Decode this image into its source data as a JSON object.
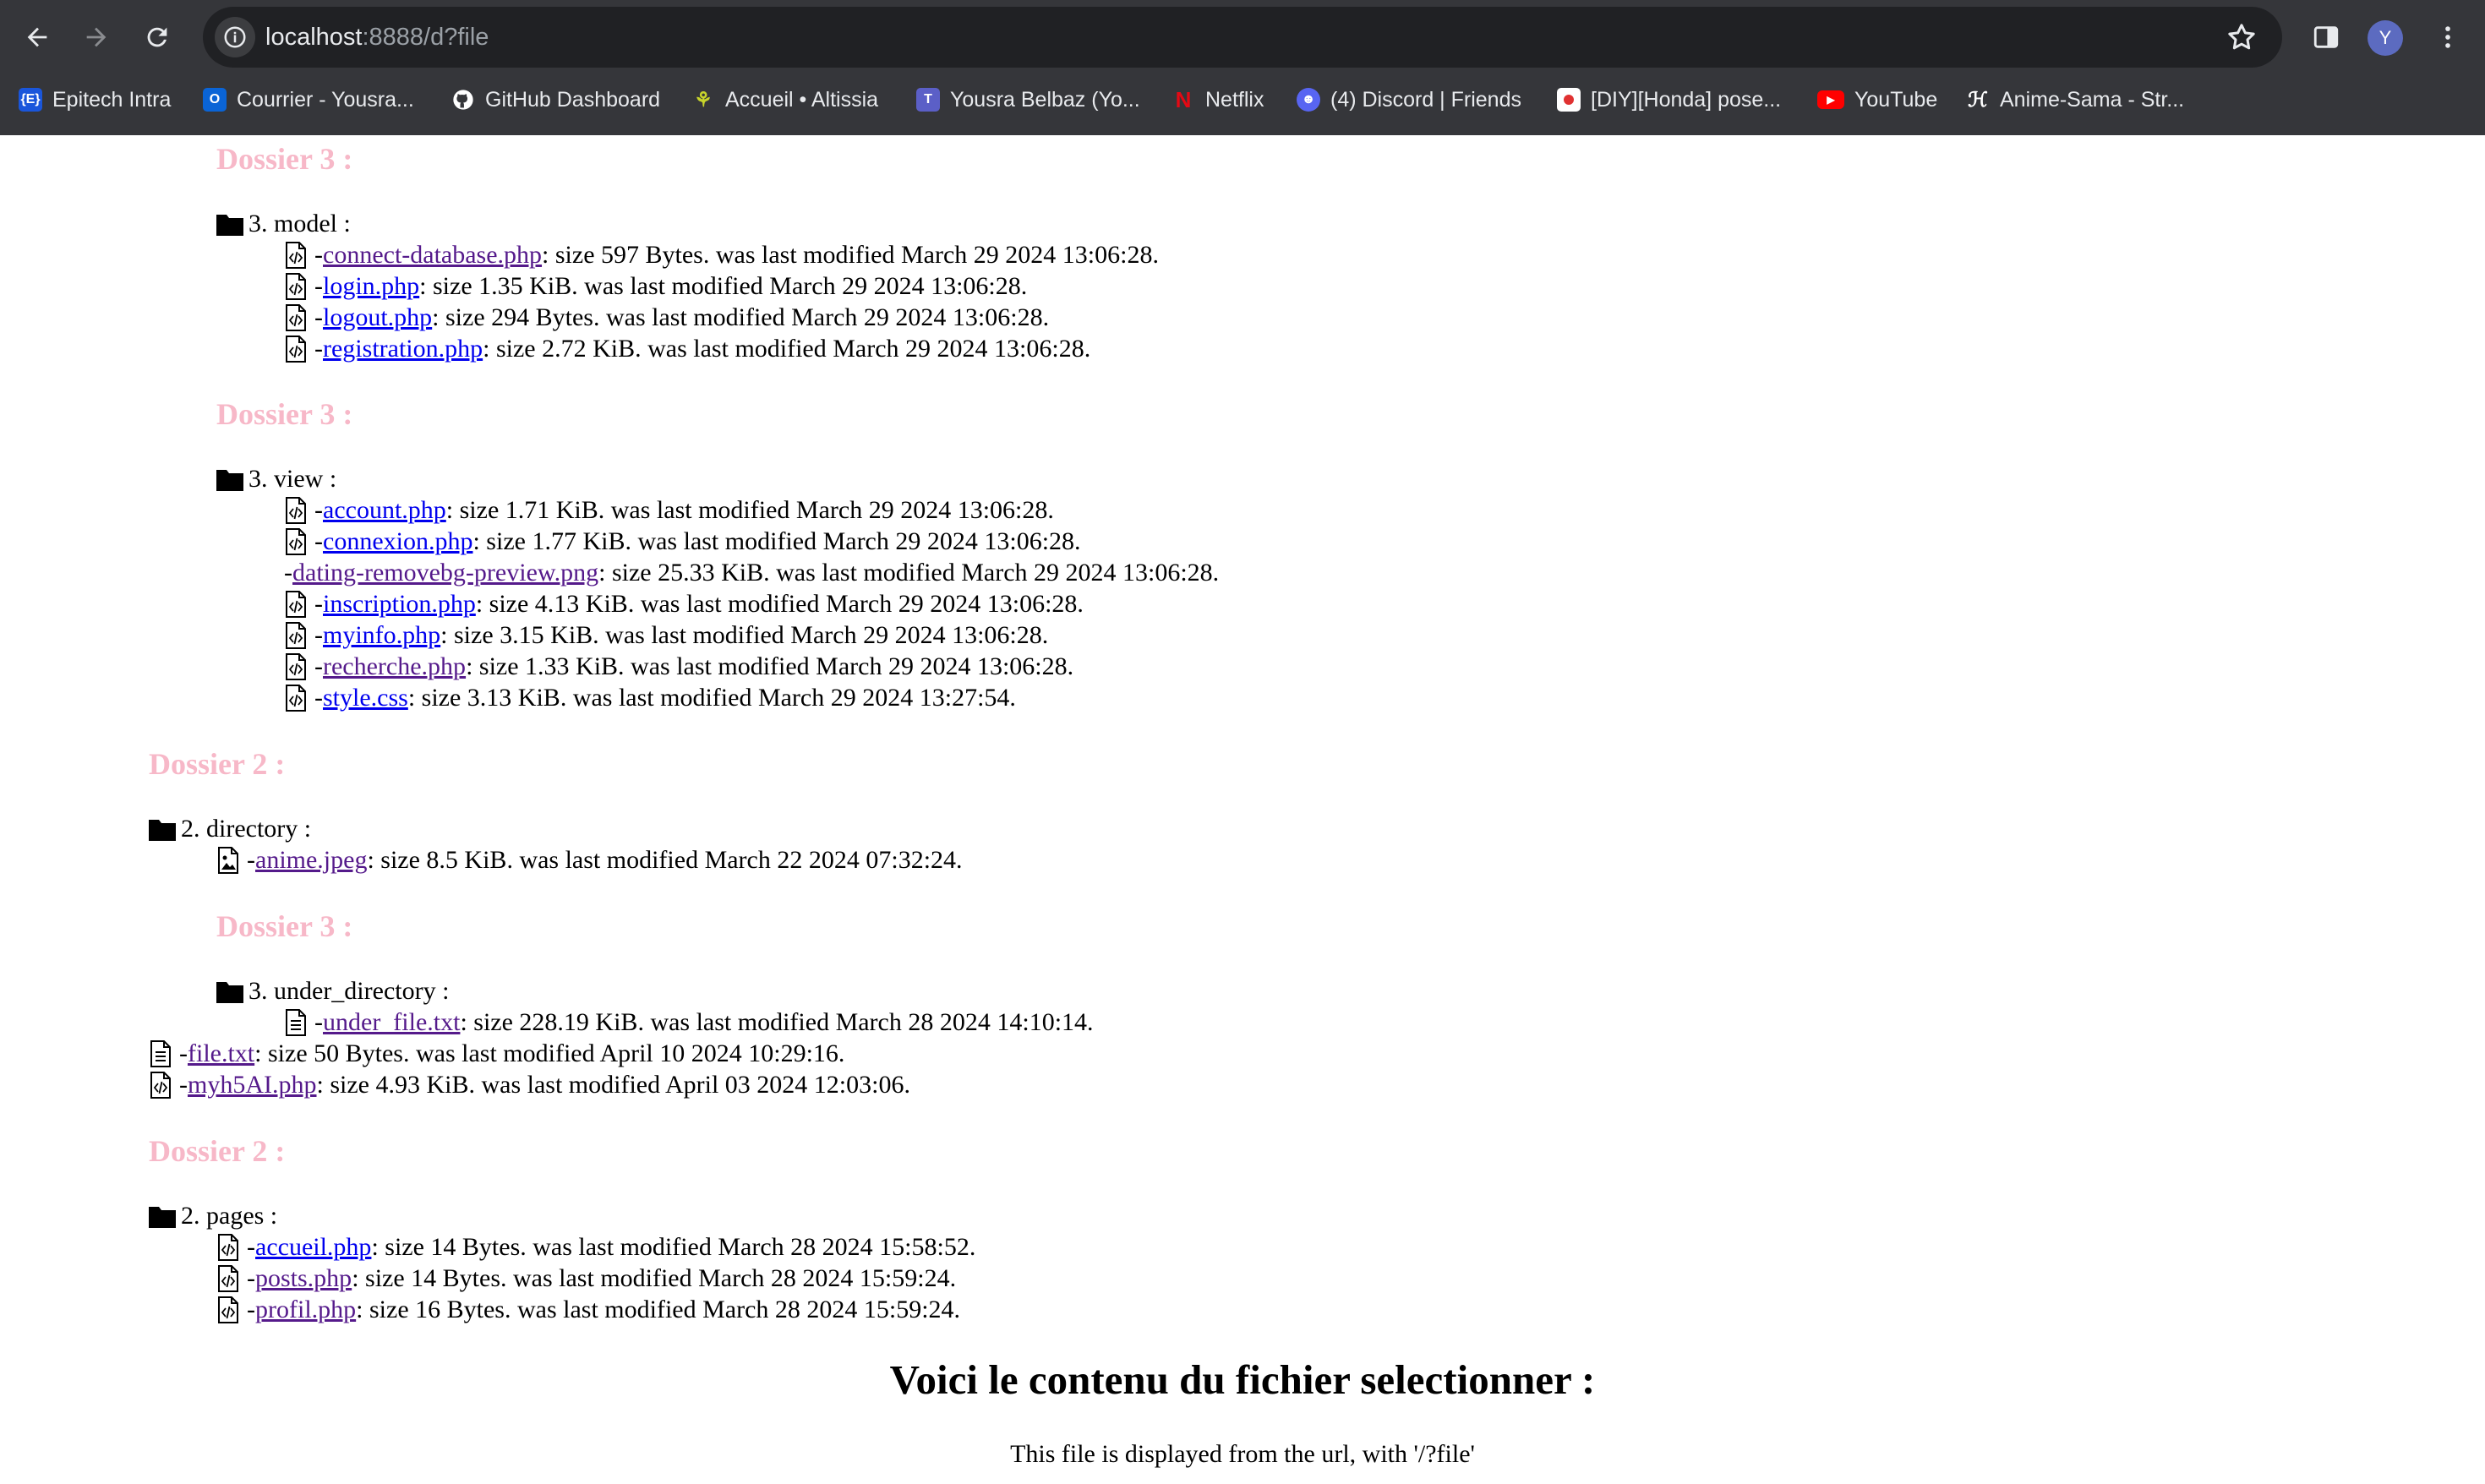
{
  "browser": {
    "url_host": "localhost",
    "url_rest": ":8888/d?file",
    "profile_initial": "Y",
    "bookmarks": [
      {
        "label": "Epitech Intra",
        "icon": "epitech-icon",
        "color": "#1a56db"
      },
      {
        "label": "Courrier - Yousra...",
        "icon": "outlook-icon",
        "color": "#0a64d6"
      },
      {
        "label": "GitHub Dashboard",
        "icon": "github-icon",
        "color": "#ffffff"
      },
      {
        "label": "Accueil • Altissia",
        "icon": "altissia-icon",
        "color": "#c7d42b"
      },
      {
        "label": "Yousra Belbaz (Yo...",
        "icon": "teams-icon",
        "color": "#5b5fc7"
      },
      {
        "label": "Netflix",
        "icon": "netflix-icon",
        "color": "#e50914"
      },
      {
        "label": "(4) Discord | Friends",
        "icon": "discord-icon",
        "color": "#5865f2"
      },
      {
        "label": "[DIY][Honda] pose...",
        "icon": "japan-flag-icon",
        "color": "#ffffff"
      },
      {
        "label": "YouTube",
        "icon": "youtube-icon",
        "color": "#ff0000"
      },
      {
        "label": "Anime-Sama - Str...",
        "icon": "anime-sama-icon",
        "color": "#ffffff"
      }
    ]
  },
  "content": {
    "dossier_3": "Dossier 3 :",
    "dossier_2": "Dossier 2 :",
    "model_folder": "3. model :",
    "model_files": [
      {
        "name": "connect-database.php",
        "info": " : size 597 Bytes. was last modified March 29 2024 13:06:28.",
        "visited": true
      },
      {
        "name": "login.php",
        "info": " : size 1.35 KiB. was last modified March 29 2024 13:06:28.",
        "visited": false
      },
      {
        "name": "logout.php",
        "info": " : size 294 Bytes. was last modified March 29 2024 13:06:28.",
        "visited": false
      },
      {
        "name": "registration.php",
        "info": " : size 2.72 KiB. was last modified March 29 2024 13:06:28.",
        "visited": false
      }
    ],
    "view_folder": "3. view :",
    "view_files": [
      {
        "name": "account.php",
        "info": " : size 1.71 KiB. was last modified March 29 2024 13:06:28.",
        "visited": false
      },
      {
        "name": "connexion.php",
        "info": " : size 1.77 KiB. was last modified March 29 2024 13:06:28.",
        "visited": false
      },
      {
        "name": "dating-removebg-preview.png",
        "info": " : size 25.33 KiB. was last modified March 29 2024 13:06:28.",
        "visited": true
      },
      {
        "name": "inscription.php",
        "info": " : size 4.13 KiB. was last modified March 29 2024 13:06:28.",
        "visited": false
      },
      {
        "name": "myinfo.php",
        "info": " : size 3.15 KiB. was last modified March 29 2024 13:06:28.",
        "visited": false
      },
      {
        "name": "recherche.php",
        "info": " : size 1.33 KiB. was last modified March 29 2024 13:06:28.",
        "visited": true
      },
      {
        "name": "style.css",
        "info": " : size 3.13 KiB. was last modified March 29 2024 13:27:54.",
        "visited": false
      }
    ],
    "directory_folder": "2. directory :",
    "directory_files": [
      {
        "name": "anime.jpeg",
        "info": " : size 8.5 KiB. was last modified March 22 2024 07:32:24.",
        "visited": true
      }
    ],
    "under_directory_folder": "3. under_directory :",
    "under_directory_files": [
      {
        "name": "under_file.txt",
        "info": " : size 228.19 KiB. was last modified March 28 2024 14:10:14.",
        "visited": true
      }
    ],
    "root_files": [
      {
        "name": "file.txt",
        "info": " : size 50 Bytes. was last modified April 10 2024 10:29:16.",
        "visited": true
      },
      {
        "name": "myh5AI.php",
        "info": " : size 4.93 KiB. was last modified April 03 2024 12:03:06.",
        "visited": true
      }
    ],
    "pages_folder": "2. pages :",
    "pages_files": [
      {
        "name": "accueil.php",
        "info": " : size 14 Bytes. was last modified March 28 2024 15:58:52.",
        "visited": false
      },
      {
        "name": "posts.php",
        "info": " : size 14 Bytes. was last modified March 28 2024 15:59:24.",
        "visited": true
      },
      {
        "name": "profil.php",
        "info": " : size 16 Bytes. was last modified March 28 2024 15:59:24.",
        "visited": true
      }
    ],
    "file_heading": "Voici le contenu du fichier selectionner :",
    "file_body": "This file is displayed from the url, with '/?file'",
    "dash": "- "
  }
}
